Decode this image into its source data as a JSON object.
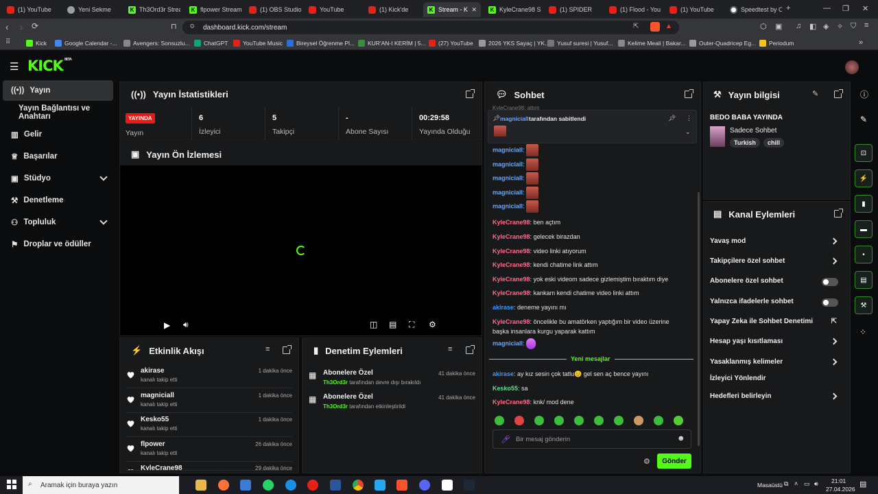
{
  "browser": {
    "tabs": [
      {
        "label": "(1) YouTube",
        "fav": "yt"
      },
      {
        "label": "Yeni Sekme",
        "fav": "shield"
      },
      {
        "label": "Th3Ord3r Stream",
        "fav": "kick"
      },
      {
        "label": "flpower Stream",
        "fav": "kick"
      },
      {
        "label": "(1) OBS Studio",
        "fav": "yt"
      },
      {
        "label": "YouTube",
        "fav": "yt"
      },
      {
        "label": "(1) Kick'de",
        "fav": "yt"
      },
      {
        "label": "Stream - K",
        "fav": "kick"
      },
      {
        "label": "KyleCrane98 St",
        "fav": "kick"
      },
      {
        "label": "(1) SPIDER",
        "fav": "yt"
      },
      {
        "label": "(1) Flood - You",
        "fav": "yt"
      },
      {
        "label": "(1) YouTube",
        "fav": "yt"
      },
      {
        "label": "Speedtest by O",
        "fav": "clock"
      }
    ],
    "url": "dashboard.kick.com/stream",
    "bookmarks": [
      "Kick",
      "Google Calendar -...",
      "Avengers: Sonsuzlu...",
      "ChatGPT",
      "YouTube Music",
      "Bireysel Öğrenme Pl...",
      "KUR'AN-I KERİM | 5...",
      "(27) YouTube",
      "2026 YKS Sayaç | YK...",
      "Yusuf suresi | Yusuf...",
      "Kelime Meali | Bakar...",
      "Outer-Quadricep Eg...",
      "Periodum"
    ]
  },
  "app": {
    "logo": "KICK",
    "logo_sup": "BETA"
  },
  "sidebar": {
    "items": [
      {
        "label": "Yayın"
      },
      {
        "label": "Yayın Bağlantısı ve Anahtarı"
      },
      {
        "label": "Gelir"
      },
      {
        "label": "Başarılar"
      },
      {
        "label": "Stüdyo"
      },
      {
        "label": "Denetleme"
      },
      {
        "label": "Topluluk"
      },
      {
        "label": "Droplar ve ödüller"
      }
    ]
  },
  "stats": {
    "title": "Yayın İstatistikleri",
    "live_badge": "YAYINDA",
    "live_label": "Yayın",
    "items": [
      {
        "value": "6",
        "label": "İzleyici"
      },
      {
        "value": "5",
        "label": "Takipçi"
      },
      {
        "value": "-",
        "label": "Abone Sayısı"
      },
      {
        "value": "00:29:58",
        "label": "Yayında Olduğu"
      }
    ]
  },
  "preview": {
    "title": "Yayın Ön İzlemesi"
  },
  "feed": {
    "title": "Etkinlik Akışı",
    "items": [
      {
        "name": "akirase",
        "sub": "kanalı takip etti",
        "time": "1 dakika önce"
      },
      {
        "name": "magniciall",
        "sub": "kanalı takip etti",
        "time": "1 dakika önce"
      },
      {
        "name": "Kesko55",
        "sub": "kanalı takip etti",
        "time": "1 dakika önce"
      },
      {
        "name": "flpower",
        "sub": "kanalı takip etti",
        "time": "26 dakika önce"
      },
      {
        "name": "KyleCrane98",
        "sub": "",
        "time": "29 dakika önce"
      }
    ]
  },
  "moderation": {
    "title": "Denetim Eylemleri",
    "items": [
      {
        "name": "Abonelere Özel",
        "user": "Th3Ord3r",
        "rest": " tarafından devre dışı bırakıldı",
        "time": "41 dakika önce"
      },
      {
        "name": "Abonelere Özel",
        "user": "Th3Ord3r",
        "rest": " tarafından etkinleştirildi",
        "time": "41 dakika önce"
      }
    ]
  },
  "chat": {
    "title": "Sohbet",
    "pinned_user": "magniciall",
    "pinned_by": " tarafından sabitlendi",
    "partial_top": "KyleCrane98: attım",
    "messages": [
      {
        "user": "magniciall",
        "color": "#6ea8ff",
        "text": "",
        "emote": true
      },
      {
        "user": "magniciall",
        "color": "#6ea8ff",
        "text": "",
        "emote": true
      },
      {
        "user": "magniciall",
        "color": "#6ea8ff",
        "text": "",
        "emote": true
      },
      {
        "user": "magniciall",
        "color": "#6ea8ff",
        "text": "",
        "emote": true
      },
      {
        "user": "magniciall",
        "color": "#6ea8ff",
        "text": "",
        "emote": true
      },
      {
        "user": "KyleCrane98",
        "color": "#ff6b8a",
        "text": "ben açtım"
      },
      {
        "user": "KyleCrane98",
        "color": "#ff6b8a",
        "text": "gelecek birazdan"
      },
      {
        "user": "KyleCrane98",
        "color": "#ff6b8a",
        "text": "video linki atıyorum"
      },
      {
        "user": "KyleCrane98",
        "color": "#ff6b8a",
        "text": "kendi chatime link attım"
      },
      {
        "user": "KyleCrane98",
        "color": "#ff6b8a",
        "text": "yok eski videom sadece gizlemiştim bıraktım diye"
      },
      {
        "user": "KyleCrane98",
        "color": "#ff6b8a",
        "text": "kankam kendi chatime video linki attım"
      },
      {
        "user": "akirase",
        "color": "#3a9bff",
        "text": "deneme yayını mı"
      },
      {
        "user": "KyleCrane98",
        "color": "#ff6b8a",
        "text": "öncelikle bu amatörken yaptığım bir video üzerine"
      },
      {
        "user": "",
        "color": "#ff6b8a",
        "text": "başka insanlara kurgu yaparak kattım"
      },
      {
        "user": "magniciall",
        "color": "#6ea8ff",
        "text": "",
        "emote": true
      }
    ],
    "new_messages_label": "Yeni mesajlar",
    "new_messages": [
      {
        "user": "akirase",
        "color": "#3a9bff",
        "text": "ay kız sesin çok tatlu😊 gel sen aç bence yayını"
      },
      {
        "user": "Kesko55",
        "color": "#5ee28b",
        "text": "sa"
      },
      {
        "user": "KyleCrane98",
        "color": "#ff6b8a",
        "text": "knk/ mod dene"
      }
    ],
    "input_placeholder": "Bir mesaj gönderin",
    "send_label": "Gönder"
  },
  "stream_info": {
    "title": "Yayın bilgisi",
    "stream_title": "BEDO BABA YAYINDA",
    "category": "Sadece Sohbet",
    "tags": [
      "Turkish",
      "chill"
    ]
  },
  "channel_actions": {
    "title": "Kanal Eylemleri",
    "items": [
      {
        "label": "Yavaş mod",
        "control": "arrow"
      },
      {
        "label": "Takipçilere özel sohbet",
        "control": "arrow"
      },
      {
        "label": "Abonelere özel sohbet",
        "control": "toggle"
      },
      {
        "label": "Yalnızca ifadelerle sohbet",
        "control": "toggle"
      },
      {
        "label": "Yapay Zeka ile Sohbet Denetimi",
        "control": "external"
      },
      {
        "label": "Hesap yaşı kısıtlaması",
        "control": "arrow"
      },
      {
        "label": "Yasaklanmış kelimeler",
        "control": "arrow"
      },
      {
        "label": "İzleyici Yönlendir",
        "control": "none"
      },
      {
        "label": "Hedefleri belirleyin",
        "control": "arrow"
      }
    ]
  },
  "taskbar": {
    "search_placeholder": "Aramak için buraya yazın",
    "desktop_label": "Masaüstü",
    "time": "21:01",
    "date": "27.04.2026"
  },
  "colors": {
    "accent": "#53fc18",
    "live": "#e91916",
    "panel": "#18191b",
    "bg": "#0b0c0d"
  }
}
